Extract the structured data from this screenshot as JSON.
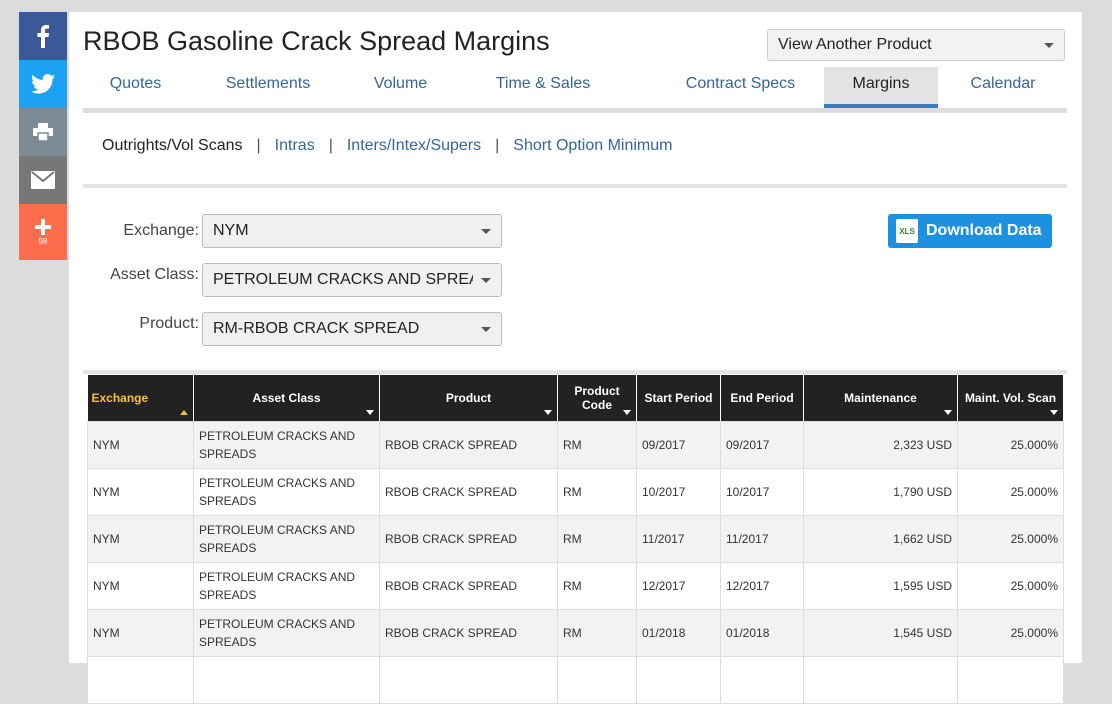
{
  "social": {
    "share_count": "98",
    "icons": [
      "facebook-icon",
      "twitter-icon",
      "print-icon",
      "email-icon",
      "plus-icon"
    ]
  },
  "page_title": "RBOB Gasoline Crack Spread Margins",
  "product_select": {
    "value": "View Another Product"
  },
  "tabs": [
    {
      "label": "Quotes"
    },
    {
      "label": "Settlements"
    },
    {
      "label": "Volume"
    },
    {
      "label": "Time & Sales"
    },
    {
      "label": "Contract Specs"
    },
    {
      "label": "Margins",
      "active": true
    },
    {
      "label": "Calendar"
    }
  ],
  "subnav": {
    "current": "Outrights/Vol Scans",
    "links": [
      "Intras",
      "Inters/Intex/Supers",
      "Short Option Minimum"
    ],
    "separator": "|"
  },
  "filters": {
    "exchange": {
      "label": "Exchange:",
      "value": "NYM"
    },
    "asset_class": {
      "label": "Asset Class:",
      "value": "PETROLEUM CRACKS AND SPREADS"
    },
    "product": {
      "label": "Product:",
      "value": "RM-RBOB CRACK SPREAD"
    }
  },
  "download": {
    "label": "Download Data",
    "icon_text": "XLS"
  },
  "table": {
    "headers": [
      {
        "label": "Exchange"
      },
      {
        "label": "Asset Class"
      },
      {
        "label": "Product"
      },
      {
        "label": "Product Code"
      },
      {
        "label": "Start Period"
      },
      {
        "label": "End Period"
      },
      {
        "label": "Maintenance"
      },
      {
        "label": "Maint. Vol. Scan"
      }
    ],
    "rows": [
      [
        "NYM",
        "PETROLEUM CRACKS AND SPREADS",
        "RBOB CRACK SPREAD",
        "RM",
        "09/2017",
        "09/2017",
        "2,323 USD",
        "25.000%"
      ],
      [
        "NYM",
        "PETROLEUM CRACKS AND SPREADS",
        "RBOB CRACK SPREAD",
        "RM",
        "10/2017",
        "10/2017",
        "1,790 USD",
        "25.000%"
      ],
      [
        "NYM",
        "PETROLEUM CRACKS AND SPREADS",
        "RBOB CRACK SPREAD",
        "RM",
        "11/2017",
        "11/2017",
        "1,662 USD",
        "25.000%"
      ],
      [
        "NYM",
        "PETROLEUM CRACKS AND SPREADS",
        "RBOB CRACK SPREAD",
        "RM",
        "12/2017",
        "12/2017",
        "1,595 USD",
        "25.000%"
      ],
      [
        "NYM",
        "PETROLEUM CRACKS AND SPREADS",
        "RBOB CRACK SPREAD",
        "RM",
        "01/2018",
        "01/2018",
        "1,545 USD",
        "25.000%"
      ],
      [
        "",
        "",
        "",
        "",
        "",
        "",
        "",
        ""
      ]
    ]
  }
}
